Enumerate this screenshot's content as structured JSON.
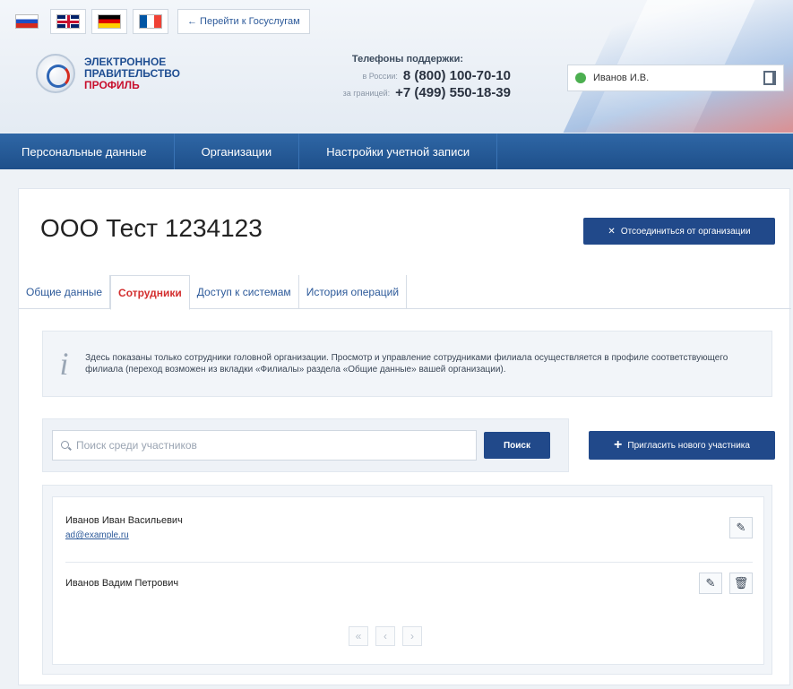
{
  "header": {
    "languages": [
      {
        "code": "ru",
        "icon": "flag-ru-icon",
        "active": true
      },
      {
        "code": "en",
        "icon": "flag-uk-icon",
        "active": false
      },
      {
        "code": "de",
        "icon": "flag-de-icon",
        "active": false
      },
      {
        "code": "fr",
        "icon": "flag-fr-icon",
        "active": false
      }
    ],
    "goto_gosuslugi": "← Перейти к Госуслугам",
    "logo": {
      "line1": "ЭЛЕКТРОННОЕ",
      "line2": "ПРАВИТЕЛЬСТВО",
      "line3": "ПРОФИЛЬ"
    },
    "support": {
      "title": "Телефоны поддержки:",
      "rows": [
        {
          "label": "в России:",
          "number": "8 (800) 100-70-10"
        },
        {
          "label": "за границей:",
          "number": "+7 (499) 550-18-39"
        }
      ]
    },
    "user": {
      "name": "Иванов И.В.",
      "status_color": "#4caf50"
    }
  },
  "nav": {
    "items": [
      "Персональные данные",
      "Организации",
      "Настройки учетной записи"
    ]
  },
  "org": {
    "title": "ООО Тест 1234123",
    "leave_button": "Отсоединиться от организации"
  },
  "tabs": {
    "items": [
      "Общие данные",
      "Сотрудники",
      "Доступ к системам",
      "История операций"
    ],
    "active_index": 1
  },
  "info": {
    "text": "Здесь показаны только сотрудники головной организации. Просмотр и управление сотрудниками филиала осуществляется в профиле соответствующего филиала (переход возможен из вкладки «Филиалы» раздела «Общие данные» вашей организации)."
  },
  "search": {
    "placeholder": "Поиск среди участников",
    "button": "Поиск"
  },
  "invite_button": "Пригласить нового участника",
  "employees": [
    {
      "name": "Иванов Иван Васильевич",
      "email": "ad@example.ru",
      "can_delete": false
    },
    {
      "name": "Иванов Вадим Петрович",
      "email": "",
      "can_delete": true
    }
  ],
  "pager": {
    "first": "«",
    "prev": "‹",
    "next": "›"
  },
  "colors": {
    "primary_button": "#21498a",
    "nav_bar": "#2f67a6",
    "active_tab": "#d32f2f",
    "link": "#2d5a9a"
  }
}
